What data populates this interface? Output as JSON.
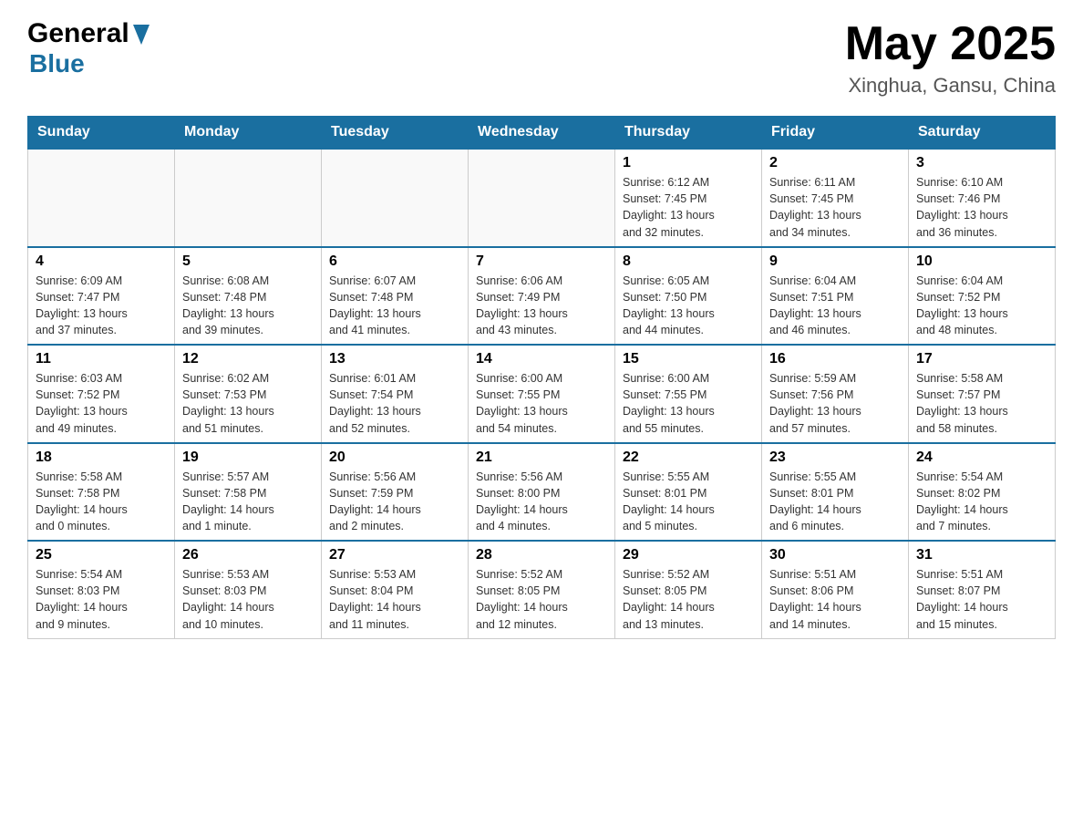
{
  "header": {
    "logo_general": "General",
    "logo_blue": "Blue",
    "month_title": "May 2025",
    "location": "Xinghua, Gansu, China"
  },
  "days_of_week": [
    "Sunday",
    "Monday",
    "Tuesday",
    "Wednesday",
    "Thursday",
    "Friday",
    "Saturday"
  ],
  "weeks": [
    {
      "days": [
        {
          "number": "",
          "info": ""
        },
        {
          "number": "",
          "info": ""
        },
        {
          "number": "",
          "info": ""
        },
        {
          "number": "",
          "info": ""
        },
        {
          "number": "1",
          "info": "Sunrise: 6:12 AM\nSunset: 7:45 PM\nDaylight: 13 hours\nand 32 minutes."
        },
        {
          "number": "2",
          "info": "Sunrise: 6:11 AM\nSunset: 7:45 PM\nDaylight: 13 hours\nand 34 minutes."
        },
        {
          "number": "3",
          "info": "Sunrise: 6:10 AM\nSunset: 7:46 PM\nDaylight: 13 hours\nand 36 minutes."
        }
      ]
    },
    {
      "days": [
        {
          "number": "4",
          "info": "Sunrise: 6:09 AM\nSunset: 7:47 PM\nDaylight: 13 hours\nand 37 minutes."
        },
        {
          "number": "5",
          "info": "Sunrise: 6:08 AM\nSunset: 7:48 PM\nDaylight: 13 hours\nand 39 minutes."
        },
        {
          "number": "6",
          "info": "Sunrise: 6:07 AM\nSunset: 7:48 PM\nDaylight: 13 hours\nand 41 minutes."
        },
        {
          "number": "7",
          "info": "Sunrise: 6:06 AM\nSunset: 7:49 PM\nDaylight: 13 hours\nand 43 minutes."
        },
        {
          "number": "8",
          "info": "Sunrise: 6:05 AM\nSunset: 7:50 PM\nDaylight: 13 hours\nand 44 minutes."
        },
        {
          "number": "9",
          "info": "Sunrise: 6:04 AM\nSunset: 7:51 PM\nDaylight: 13 hours\nand 46 minutes."
        },
        {
          "number": "10",
          "info": "Sunrise: 6:04 AM\nSunset: 7:52 PM\nDaylight: 13 hours\nand 48 minutes."
        }
      ]
    },
    {
      "days": [
        {
          "number": "11",
          "info": "Sunrise: 6:03 AM\nSunset: 7:52 PM\nDaylight: 13 hours\nand 49 minutes."
        },
        {
          "number": "12",
          "info": "Sunrise: 6:02 AM\nSunset: 7:53 PM\nDaylight: 13 hours\nand 51 minutes."
        },
        {
          "number": "13",
          "info": "Sunrise: 6:01 AM\nSunset: 7:54 PM\nDaylight: 13 hours\nand 52 minutes."
        },
        {
          "number": "14",
          "info": "Sunrise: 6:00 AM\nSunset: 7:55 PM\nDaylight: 13 hours\nand 54 minutes."
        },
        {
          "number": "15",
          "info": "Sunrise: 6:00 AM\nSunset: 7:55 PM\nDaylight: 13 hours\nand 55 minutes."
        },
        {
          "number": "16",
          "info": "Sunrise: 5:59 AM\nSunset: 7:56 PM\nDaylight: 13 hours\nand 57 minutes."
        },
        {
          "number": "17",
          "info": "Sunrise: 5:58 AM\nSunset: 7:57 PM\nDaylight: 13 hours\nand 58 minutes."
        }
      ]
    },
    {
      "days": [
        {
          "number": "18",
          "info": "Sunrise: 5:58 AM\nSunset: 7:58 PM\nDaylight: 14 hours\nand 0 minutes."
        },
        {
          "number": "19",
          "info": "Sunrise: 5:57 AM\nSunset: 7:58 PM\nDaylight: 14 hours\nand 1 minute."
        },
        {
          "number": "20",
          "info": "Sunrise: 5:56 AM\nSunset: 7:59 PM\nDaylight: 14 hours\nand 2 minutes."
        },
        {
          "number": "21",
          "info": "Sunrise: 5:56 AM\nSunset: 8:00 PM\nDaylight: 14 hours\nand 4 minutes."
        },
        {
          "number": "22",
          "info": "Sunrise: 5:55 AM\nSunset: 8:01 PM\nDaylight: 14 hours\nand 5 minutes."
        },
        {
          "number": "23",
          "info": "Sunrise: 5:55 AM\nSunset: 8:01 PM\nDaylight: 14 hours\nand 6 minutes."
        },
        {
          "number": "24",
          "info": "Sunrise: 5:54 AM\nSunset: 8:02 PM\nDaylight: 14 hours\nand 7 minutes."
        }
      ]
    },
    {
      "days": [
        {
          "number": "25",
          "info": "Sunrise: 5:54 AM\nSunset: 8:03 PM\nDaylight: 14 hours\nand 9 minutes."
        },
        {
          "number": "26",
          "info": "Sunrise: 5:53 AM\nSunset: 8:03 PM\nDaylight: 14 hours\nand 10 minutes."
        },
        {
          "number": "27",
          "info": "Sunrise: 5:53 AM\nSunset: 8:04 PM\nDaylight: 14 hours\nand 11 minutes."
        },
        {
          "number": "28",
          "info": "Sunrise: 5:52 AM\nSunset: 8:05 PM\nDaylight: 14 hours\nand 12 minutes."
        },
        {
          "number": "29",
          "info": "Sunrise: 5:52 AM\nSunset: 8:05 PM\nDaylight: 14 hours\nand 13 minutes."
        },
        {
          "number": "30",
          "info": "Sunrise: 5:51 AM\nSunset: 8:06 PM\nDaylight: 14 hours\nand 14 minutes."
        },
        {
          "number": "31",
          "info": "Sunrise: 5:51 AM\nSunset: 8:07 PM\nDaylight: 14 hours\nand 15 minutes."
        }
      ]
    }
  ]
}
